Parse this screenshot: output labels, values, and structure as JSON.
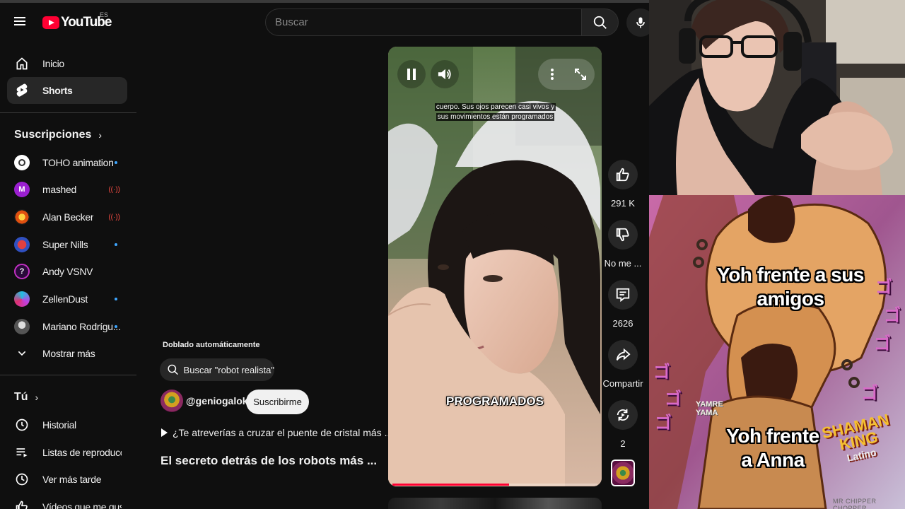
{
  "header": {
    "logo_text": "YouTube",
    "country_code": "ES",
    "search_placeholder": "Buscar"
  },
  "sidebar": {
    "main": [
      {
        "label": "Inicio",
        "icon": "home-icon"
      },
      {
        "label": "Shorts",
        "icon": "shorts-icon",
        "active": true
      }
    ],
    "subscriptions_title": "Suscripciones",
    "subscriptions": [
      {
        "label": "TOHO animation",
        "indicator": "new"
      },
      {
        "label": "mashed",
        "indicator": "live"
      },
      {
        "label": "Alan Becker",
        "indicator": "live"
      },
      {
        "label": "Super Nills",
        "indicator": "new"
      },
      {
        "label": "Andy VSNV",
        "indicator": "none"
      },
      {
        "label": "ZellenDust",
        "indicator": "new"
      },
      {
        "label": "Mariano Rodrígu...",
        "indicator": "new"
      }
    ],
    "show_more": "Mostrar más",
    "you_title": "Tú",
    "you_items": [
      {
        "label": "Historial",
        "icon": "history-icon"
      },
      {
        "label": "Listas de reproducc...",
        "icon": "playlists-icon"
      },
      {
        "label": "Ver más tarde",
        "icon": "watch-later-icon"
      },
      {
        "label": "Vídeos que me gus...",
        "icon": "liked-icon"
      }
    ]
  },
  "short": {
    "dubbed_label": "Doblado automáticamente",
    "search_chip": "Buscar \"robot realista\"",
    "channel": "@geniogalok",
    "subscribe_label": "Suscribirme",
    "related_teaser": "¿Te atreverías a cruzar el puente de cristal más ...",
    "title": "El secreto detrás de los robots más ...",
    "subtitle_line1": "cuerpo. Sus ojos parecen casi vivos y",
    "subtitle_line2": "sus movimientos están programados",
    "burned_caption": "PROGRAMADOS",
    "progress": 0.57,
    "colors": {
      "progress": "#ff0033",
      "accent_dot": "#3ea6ff",
      "live": "#ff4e45"
    }
  },
  "actions": {
    "likes": "291 K",
    "dislike_label": "No me ...",
    "comments": "2626",
    "share_label": "Compartir",
    "remix_count": "2"
  },
  "meme": {
    "top_text_line1": "Yoh frente a sus",
    "top_text_line2": "amigos",
    "bottom_text_line1": "Yoh frente",
    "bottom_text_line2": "a Anna",
    "logo_line1": "SHAMAN",
    "logo_line2": "KING",
    "logo_sub": "Latino",
    "jojo_glyph": "ゴ",
    "credit": "MR CHIPPER CHOPPER",
    "sign_text": "YAMRE YAMA"
  }
}
